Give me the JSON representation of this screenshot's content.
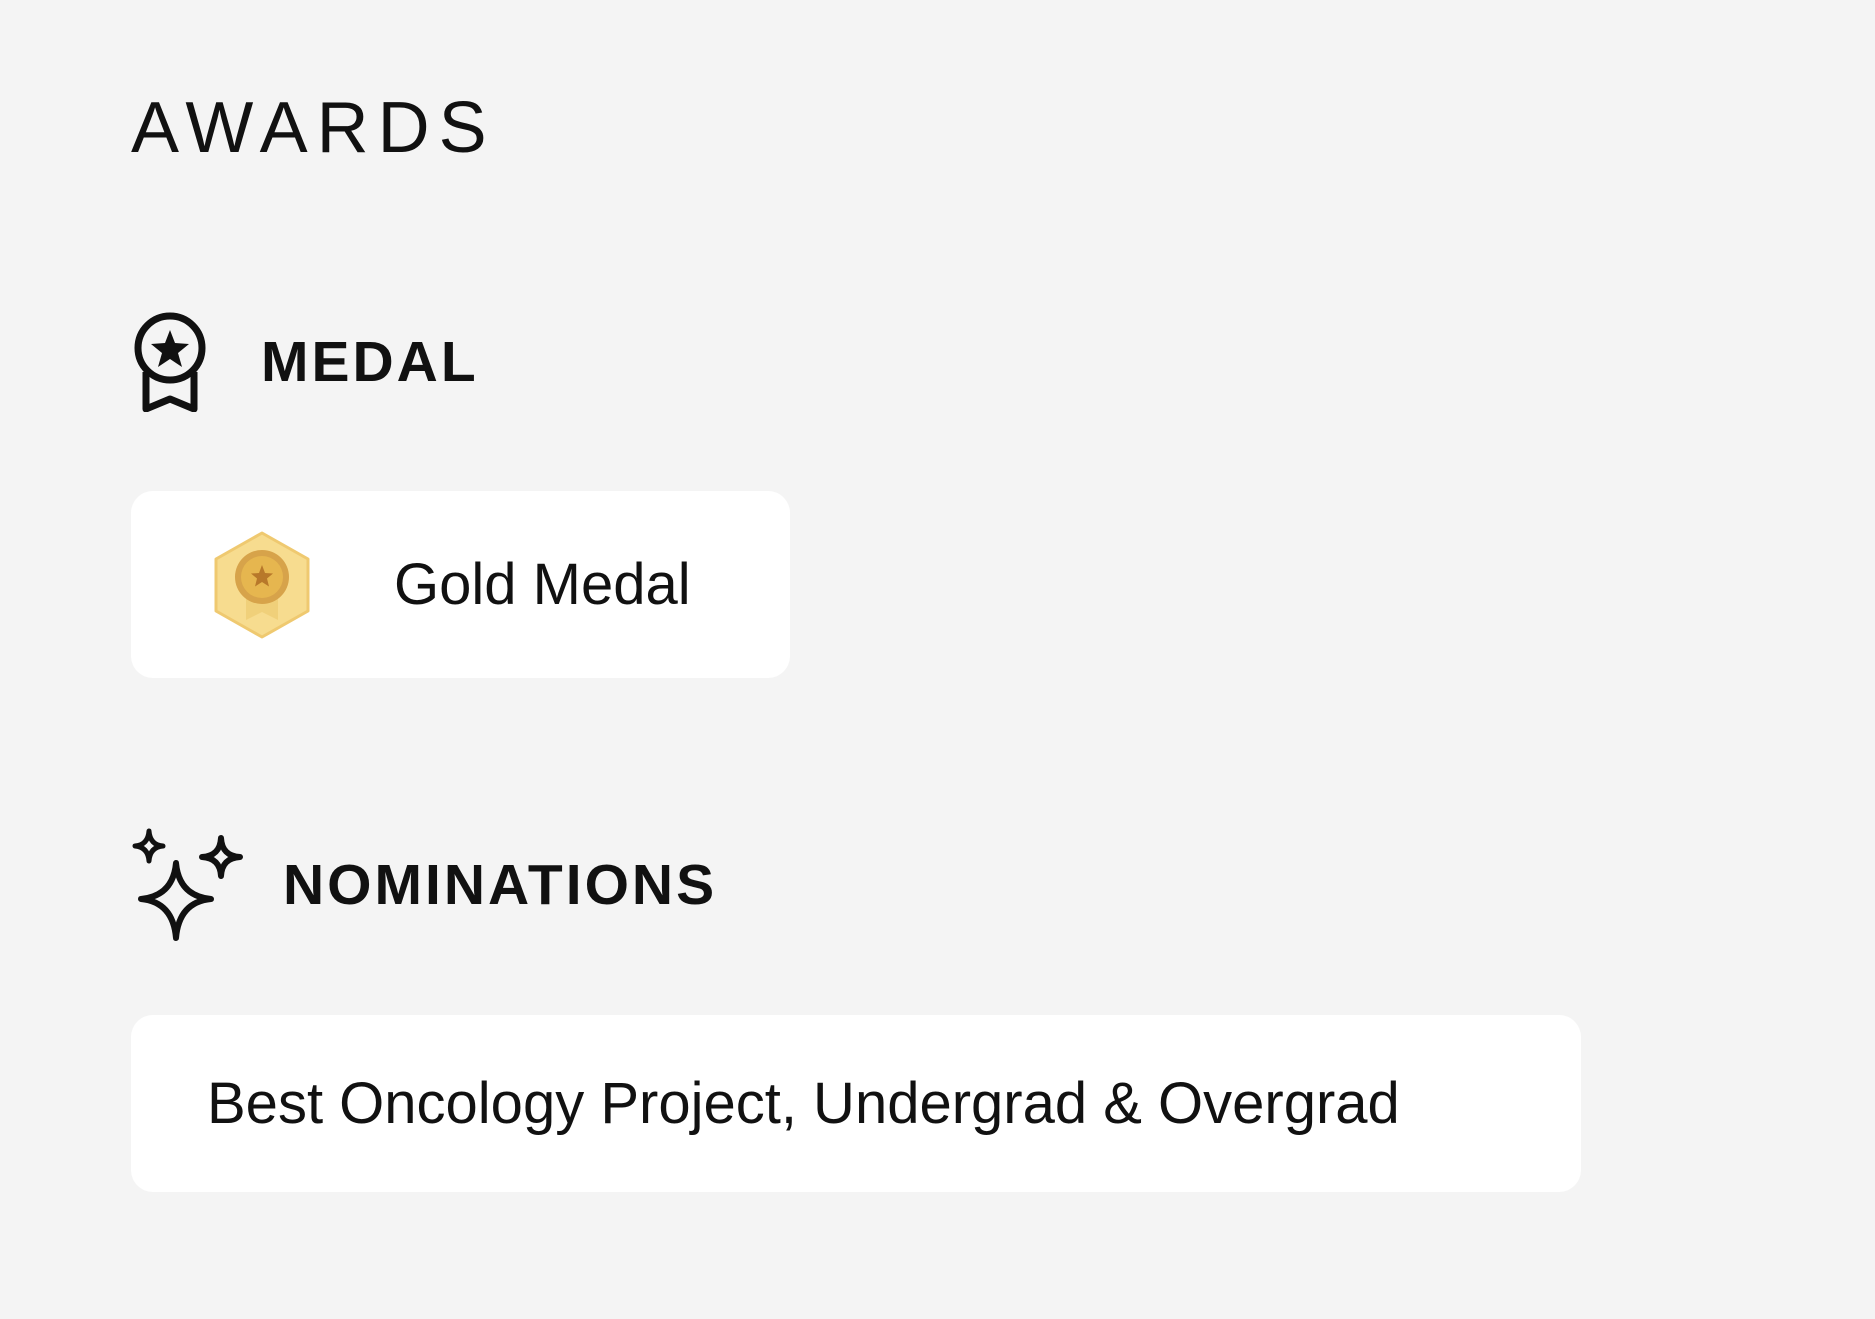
{
  "awards": {
    "title": "AWARDS",
    "medal_section": {
      "label": "MEDAL",
      "icon": "award-ribbon-icon",
      "items": [
        {
          "name": "Gold Medal",
          "icon": "gold-medal-badge-icon",
          "badge_color": "#f7dc8f"
        }
      ]
    },
    "nominations_section": {
      "label": "NOMINATIONS",
      "icon": "sparkles-icon",
      "items": [
        {
          "text": "Best Oncology Project, Undergrad & Overgrad"
        }
      ]
    }
  }
}
